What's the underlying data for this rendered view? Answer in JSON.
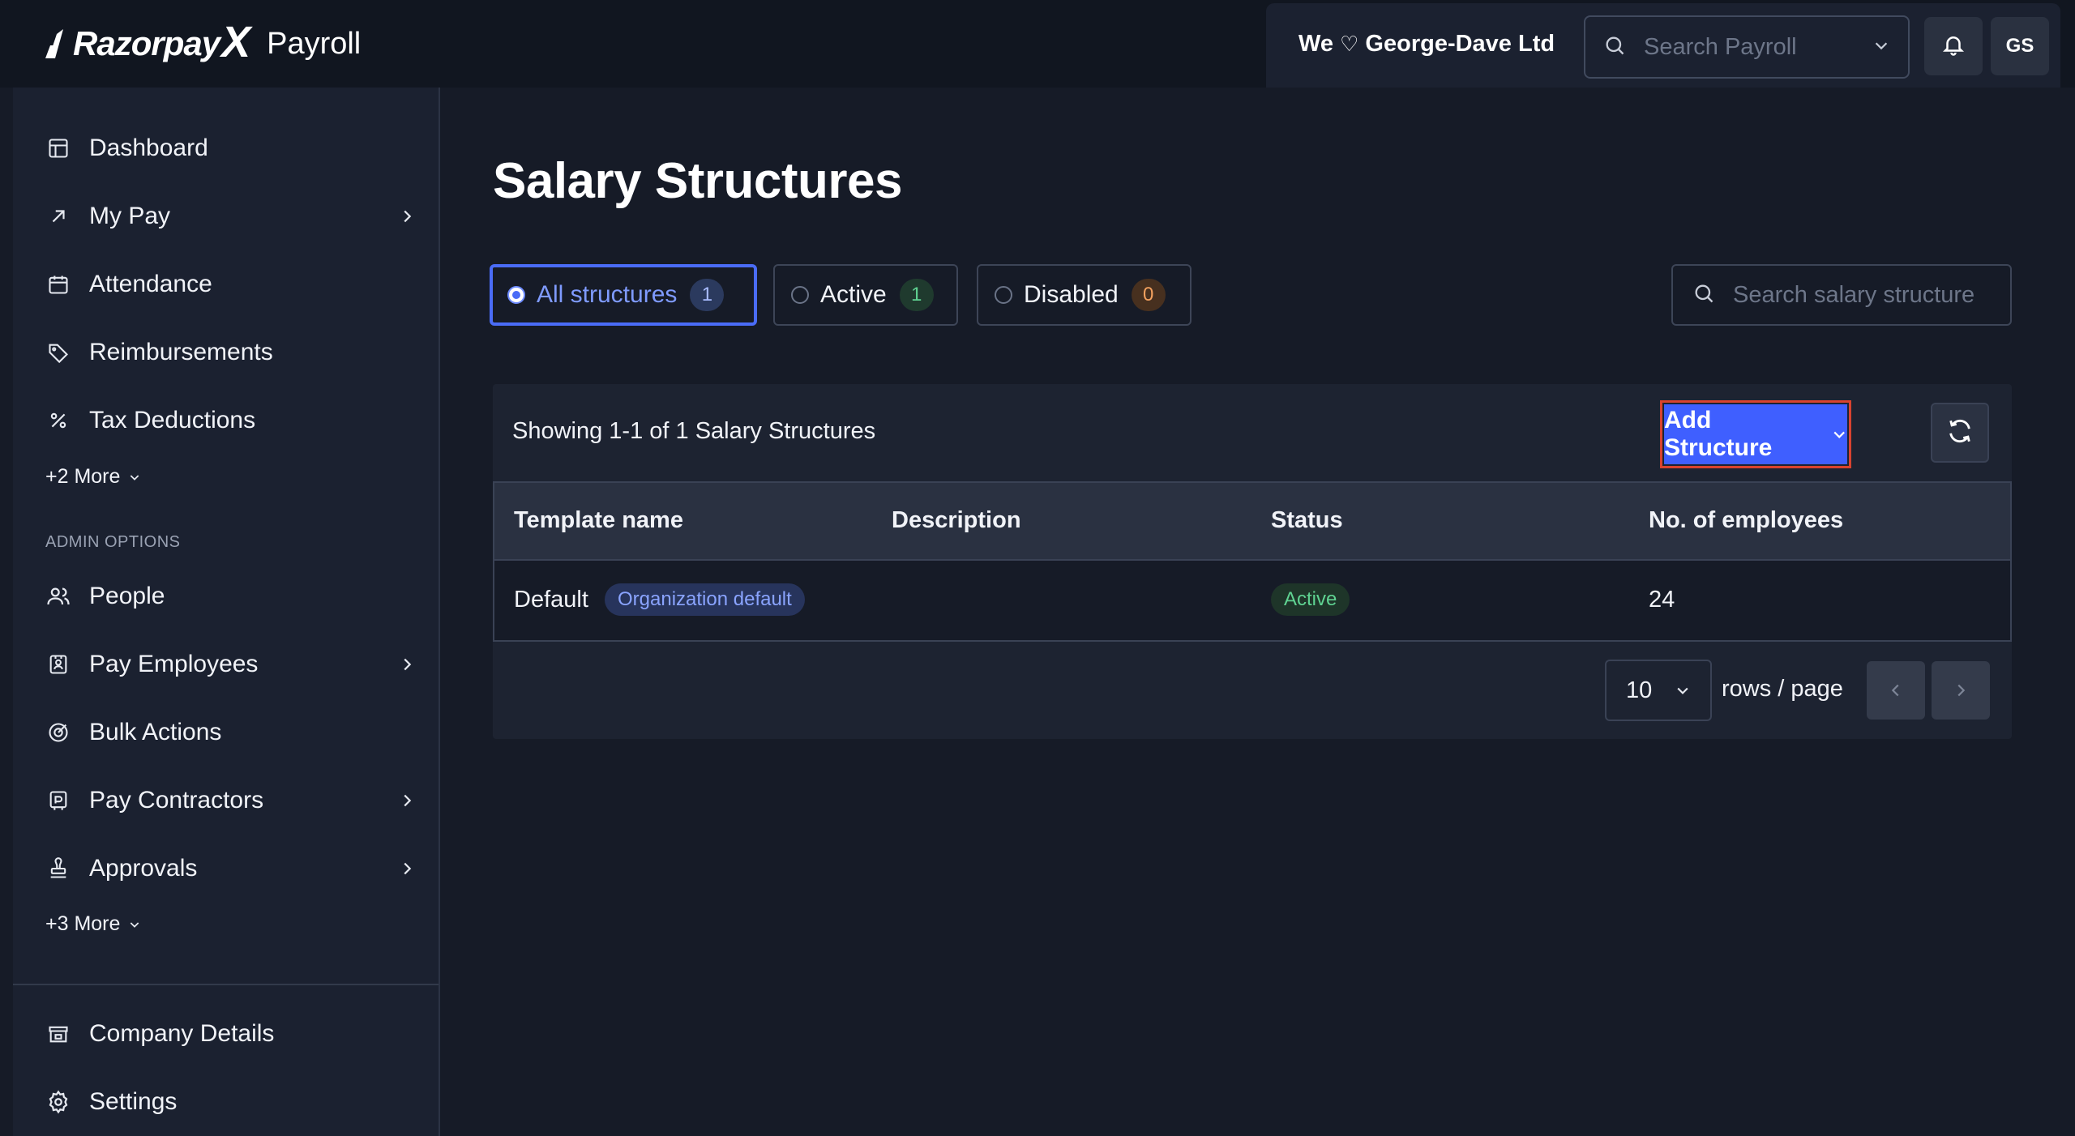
{
  "brand": {
    "name": "Razorpay",
    "x_mark": "X",
    "product": "Payroll"
  },
  "header": {
    "company_prefix": "We",
    "company_heart": "♡",
    "company_name": "George-Dave Ltd",
    "search_placeholder": "Search Payroll",
    "avatar_initials": "GS"
  },
  "sidebar": {
    "items": [
      {
        "label": "Dashboard",
        "icon": "dashboard-icon"
      },
      {
        "label": "My Pay",
        "icon": "arrow-up-right-icon",
        "has_submenu": true
      },
      {
        "label": "Attendance",
        "icon": "calendar-icon"
      },
      {
        "label": "Reimbursements",
        "icon": "tag-icon"
      },
      {
        "label": "Tax Deductions",
        "icon": "percent-icon"
      }
    ],
    "more_1": "+2 More",
    "admin_label": "ADMIN OPTIONS",
    "admin_items": [
      {
        "label": "People",
        "icon": "users-icon"
      },
      {
        "label": "Pay Employees",
        "icon": "employee-badge-icon",
        "has_submenu": true
      },
      {
        "label": "Bulk Actions",
        "icon": "target-icon"
      },
      {
        "label": "Pay Contractors",
        "icon": "contractor-icon",
        "has_submenu": true
      },
      {
        "label": "Approvals",
        "icon": "stamp-icon",
        "has_submenu": true
      }
    ],
    "more_2": "+3 More",
    "bottom_items": [
      {
        "label": "Company Details",
        "icon": "store-icon"
      },
      {
        "label": "Settings",
        "icon": "gear-icon"
      }
    ]
  },
  "main": {
    "title": "Salary Structures",
    "filters": [
      {
        "label": "All structures",
        "count": "1",
        "selected": true
      },
      {
        "label": "Active",
        "count": "1",
        "selected": false
      },
      {
        "label": "Disabled",
        "count": "0",
        "selected": false
      }
    ],
    "search_placeholder": "Search salary structure",
    "showing_text": "Showing 1-1 of 1 Salary Structures",
    "add_button": "Add Structure",
    "table": {
      "columns": [
        "Template name",
        "Description",
        "Status",
        "No. of employees"
      ],
      "rows": [
        {
          "template_name": "Default",
          "template_badge": "Organization default",
          "description": "",
          "status": "Active",
          "employees": "24"
        }
      ]
    },
    "pagination": {
      "rows_per_page": "10",
      "rows_label": "rows / page"
    }
  },
  "colors": {
    "accent": "#3f5fff",
    "highlight_frame": "#d9432f",
    "active_green": "#5fd291",
    "disabled_orange": "#f3a15f"
  }
}
